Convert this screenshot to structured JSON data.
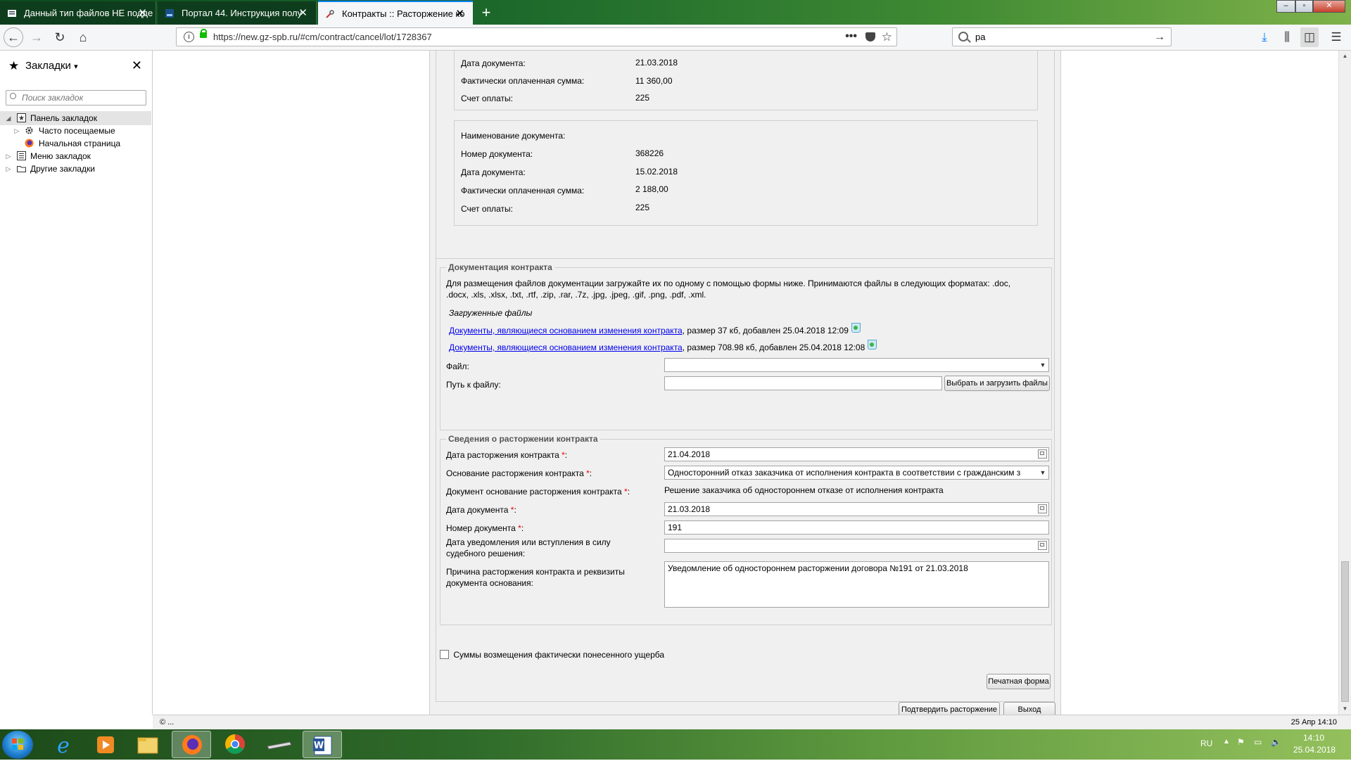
{
  "browser": {
    "tabs": [
      {
        "title": "Данный тип файлов НЕ подде",
        "active": false
      },
      {
        "title": "Портал 44. Инструкция полу",
        "active": false
      },
      {
        "title": "Контракты :: Расторжение ко",
        "active": true
      }
    ],
    "url": "https://new.gz-spb.ru/#cm/contract/cancel/lot/1728367",
    "search_value": "ра"
  },
  "sidebar": {
    "title": "Закладки",
    "search_placeholder": "Поиск закладок",
    "items": [
      {
        "label": "Панель закладок",
        "level": 0,
        "selected": true
      },
      {
        "label": "Часто посещаемые",
        "level": 1
      },
      {
        "label": "Начальная страница",
        "level": 1
      },
      {
        "label": "Меню закладок",
        "level": 0
      },
      {
        "label": "Другие закладки",
        "level": 0
      }
    ]
  },
  "payments": {
    "block1": {
      "doc_date_label": "Дата документа:",
      "doc_date": "21.03.2018",
      "paid_label": "Фактически оплаченная сумма:",
      "paid": "11 360,00",
      "account_label": "Счет оплаты:",
      "account": "225"
    },
    "block2": {
      "name_label": "Наименование документа:",
      "number_label": "Номер документа:",
      "number": "368226",
      "doc_date_label": "Дата документа:",
      "doc_date": "15.02.2018",
      "paid_label": "Фактически оплаченная сумма:",
      "paid": "2 188,00",
      "account_label": "Счет оплаты:",
      "account": "225"
    }
  },
  "docs": {
    "legend": "Документация контракта",
    "info_line1": "Для размещения файлов документации загружайте их по одному с помощью формы ниже. Принимаются файлы в следующих форматах: .doc,",
    "info_line2": ".docx, .xls, .xlsx, .txt, .rtf, .zip, .rar, .7z, .jpg, .jpeg, .gif, .png, .pdf, .xml.",
    "uploaded_title": "Загруженные файлы",
    "files": [
      {
        "link": "Документы, являющиеся основанием изменения контракта",
        "meta": ", размер 37 кб, добавлен 25.04.2018 12:09"
      },
      {
        "link": "Документы, являющиеся основанием изменения контракта",
        "meta": ", размер 708.98 кб, добавлен 25.04.2018 12:08"
      }
    ],
    "file_label": "Файл:",
    "path_label": "Путь к файлу:",
    "upload_button": "Выбрать и загрузить файлы"
  },
  "termination": {
    "legend": "Сведения о расторжении контракта",
    "date_label": "Дата расторжения контракта",
    "date": "21.04.2018",
    "reason_label": "Основание расторжения контракта",
    "reason": "Односторонний отказ заказчика от исполнения контракта в соответствии с гражданским з",
    "basis_doc_label": "Документ основание расторжения контракта",
    "basis_doc": "Решение заказчика об одностороннем отказе от исполнения контракта",
    "doc_date_label": "Дата документа",
    "doc_date": "21.03.2018",
    "doc_number_label": "Номер документа",
    "doc_number": "191",
    "notice_label_1": "Дата уведомления или вступления в силу",
    "notice_label_2": "судебного решения:",
    "cause_label_1": "Причина расторжения контракта и реквизиты",
    "cause_label_2": "документа основания:",
    "cause": "Уведомление об одностороннем расторжении договора №191 от 21.03.2018",
    "required_mark": "*",
    "colon": ":"
  },
  "damages_checkbox": "Суммы возмещения фактически понесенного ущерба",
  "buttons": {
    "print": "Печатная форма",
    "confirm": "Подтвердить расторжение",
    "exit": "Выход"
  },
  "status": {
    "left": "© ...",
    "right": "25 Апр 14:10"
  },
  "taskbar": {
    "lang": "RU",
    "time": "14:10",
    "date": "25.04.2018"
  },
  "colors": {
    "accent": "#0a84ff",
    "link": "#0000ee",
    "required": "#e00000"
  }
}
